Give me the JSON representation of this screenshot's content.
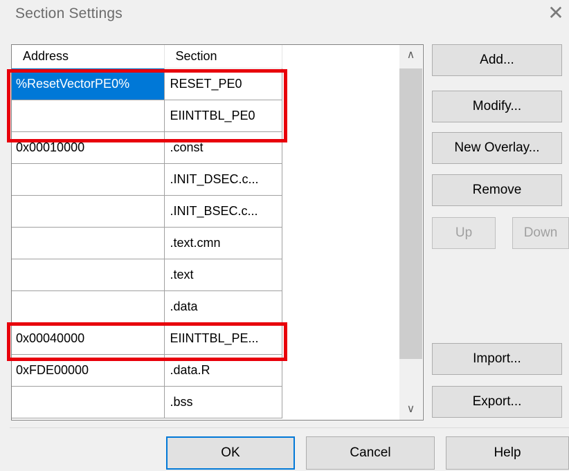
{
  "window": {
    "title": "Section Settings"
  },
  "table": {
    "headers": [
      "Address",
      "Section"
    ],
    "rows": [
      {
        "address": "%ResetVectorPE0%",
        "section": "RESET_PE0"
      },
      {
        "address": "",
        "section": "EIINTTBL_PE0"
      },
      {
        "address": "0x00010000",
        "section": ".const"
      },
      {
        "address": "",
        "section": ".INIT_DSEC.c..."
      },
      {
        "address": "",
        "section": ".INIT_BSEC.c..."
      },
      {
        "address": "",
        "section": ".text.cmn"
      },
      {
        "address": "",
        "section": ".text"
      },
      {
        "address": "",
        "section": ".data"
      },
      {
        "address": "0x00040000",
        "section": "EIINTTBL_PE..."
      },
      {
        "address": "0xFDE00000",
        "section": ".data.R"
      },
      {
        "address": "",
        "section": ".bss"
      }
    ]
  },
  "buttons": {
    "add": "Add...",
    "modify": "Modify...",
    "new_overlay": "New Overlay...",
    "remove": "Remove",
    "up": "Up",
    "down": "Down",
    "import": "Import...",
    "export": "Export...",
    "ok": "OK",
    "cancel": "Cancel",
    "help": "Help"
  },
  "icons": {
    "close": "close-icon",
    "scroll_up": "chevron-up-icon",
    "scroll_down": "chevron-down-icon"
  },
  "colors": {
    "selection": "#0078d7",
    "highlight_box": "#e8000b"
  }
}
